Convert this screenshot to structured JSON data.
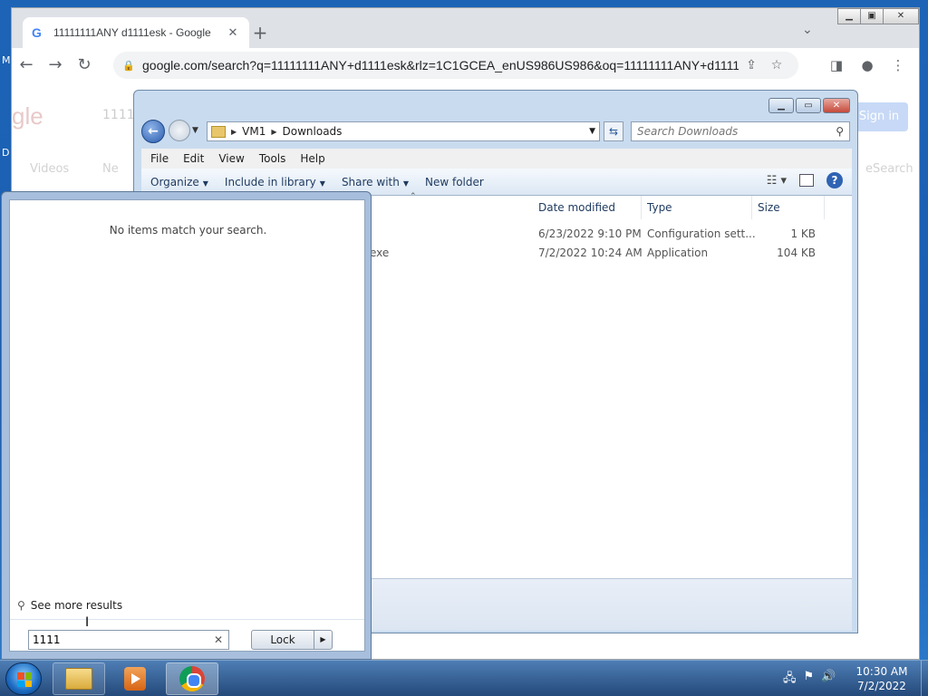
{
  "chrome": {
    "tab_title": "11111111ANY d1111esk - Google",
    "url": "google.com/search?q=11111111ANY+d1111esk&rlz=1C1GCEA_enUS986US986&oq=11111111ANY+d1111...",
    "page_logo": "gle",
    "page_query": "1111",
    "page_tab_videos": "Videos",
    "page_tab_news": "Ne",
    "page_tab_safesearch": "eSearch",
    "sign_in": "Sign in"
  },
  "explorer": {
    "breadcrumb": [
      "VM1",
      "Downloads"
    ],
    "search_placeholder": "Search Downloads",
    "menu": [
      "File",
      "Edit",
      "View",
      "Tools",
      "Help"
    ],
    "commands": {
      "organize": "Organize",
      "include_in_library": "Include in library",
      "share_with": "Share with",
      "new_folder": "New folder"
    },
    "columns": [
      "Date modified",
      "Type",
      "Size"
    ],
    "rows": [
      {
        "name_tail": "",
        "date": "6/23/2022 9:10 PM",
        "type": "Configuration sett...",
        "size": "1 KB"
      },
      {
        "name_tail": "exe",
        "date": "7/2/2022 10:24 AM",
        "type": "Application",
        "size": "104 KB"
      }
    ]
  },
  "start_search": {
    "no_items": "No items match your search.",
    "see_more": "See more results",
    "query": "1111",
    "lock_label": "Lock"
  },
  "taskbar": {
    "time": "10:30 AM",
    "date": "7/2/2022"
  },
  "desktop": {
    "letter_top": "M",
    "letter_mid": "D"
  }
}
